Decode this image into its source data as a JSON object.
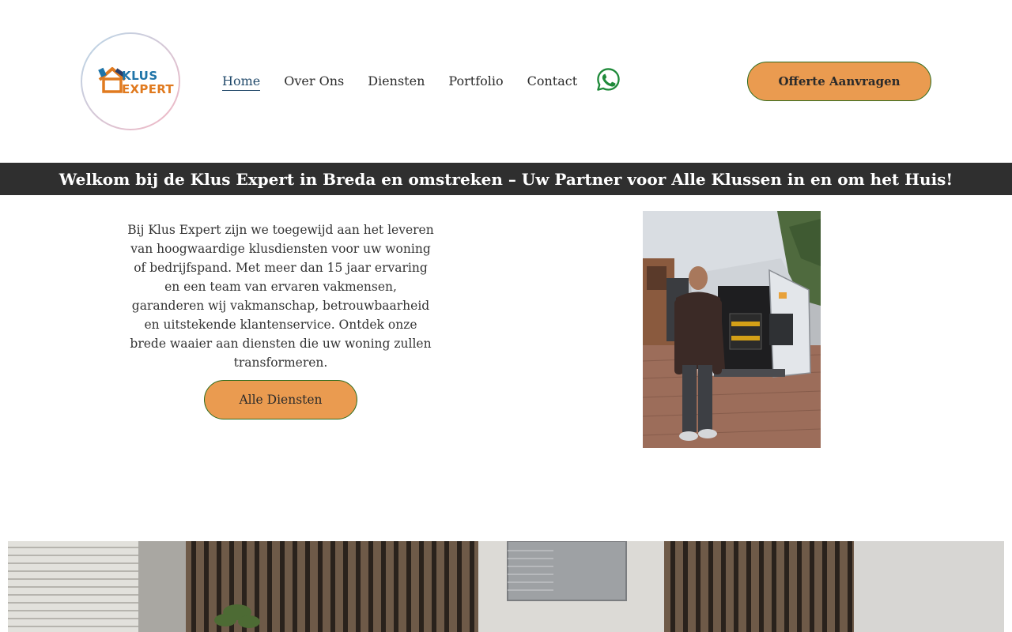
{
  "header": {
    "logo": {
      "line1": "KLUS",
      "line2": "EXPERT"
    },
    "nav": [
      {
        "label": "Home",
        "active": true
      },
      {
        "label": "Over Ons",
        "active": false
      },
      {
        "label": "Diensten",
        "active": false
      },
      {
        "label": "Portfolio",
        "active": false
      },
      {
        "label": "Contact",
        "active": false
      }
    ],
    "whatsapp_icon": "whatsapp-icon",
    "cta_label": "Offerte Aanvragen"
  },
  "banner": {
    "text": "Welkom bij de Klus Expert in Breda en omstreken – Uw Partner voor Alle Klussen in en om het Huis!"
  },
  "intro": {
    "paragraph": "Bij Klus Expert zijn we toegewijd aan het leveren van hoogwaardige klusdiensten voor uw woning of bedrijfspand. Met meer dan 15 jaar ervaring en een team van ervaren vakmensen, garanderen wij vakmanschap, betrouwbaarheid en uitstekende klantenservice. Ontdek onze brede waaier aan diensten die uw woning zullen transformeren.",
    "button_label": "Alle Diensten"
  },
  "colors": {
    "accent": "#ea9b50",
    "banner_bg": "#2f2f2f",
    "whatsapp": "#1f8a3a",
    "nav_active": "#224a6b"
  }
}
